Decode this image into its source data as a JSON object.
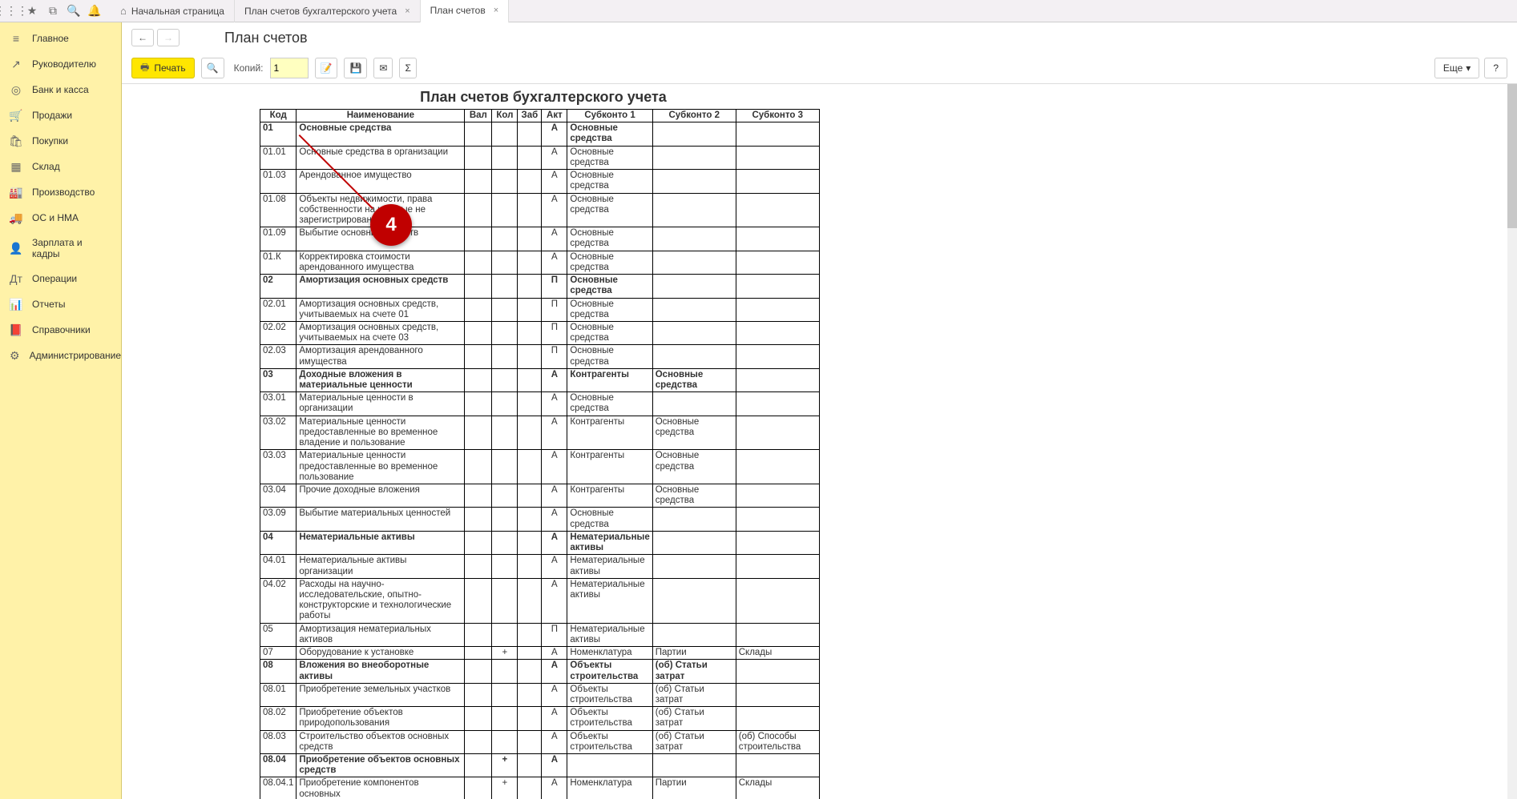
{
  "topbar": {
    "icons": [
      "apps",
      "star",
      "frames",
      "search",
      "bell"
    ]
  },
  "tabs": [
    {
      "label": "Начальная страница",
      "home": true,
      "close": false,
      "active": false
    },
    {
      "label": "План счетов бухгалтерского учета",
      "home": false,
      "close": true,
      "active": false
    },
    {
      "label": "План счетов",
      "home": false,
      "close": true,
      "active": true
    }
  ],
  "sidebar": [
    {
      "icon": "≡",
      "label": "Главное"
    },
    {
      "icon": "↗",
      "label": "Руководителю"
    },
    {
      "icon": "◎",
      "label": "Банк и касса"
    },
    {
      "icon": "🛒",
      "label": "Продажи"
    },
    {
      "icon": "🛍",
      "label": "Покупки"
    },
    {
      "icon": "▦",
      "label": "Склад"
    },
    {
      "icon": "🏭",
      "label": "Производство"
    },
    {
      "icon": "🚚",
      "label": "ОС и НМА"
    },
    {
      "icon": "👤",
      "label": "Зарплата и кадры"
    },
    {
      "icon": "Дт",
      "label": "Операции"
    },
    {
      "icon": "📊",
      "label": "Отчеты"
    },
    {
      "icon": "📕",
      "label": "Справочники"
    },
    {
      "icon": "⚙",
      "label": "Администрирование"
    }
  ],
  "page_title": "План счетов",
  "toolbar": {
    "print": "Печать",
    "copies_label": "Копий:",
    "copies_value": "1",
    "more": "Еще",
    "help": "?"
  },
  "doc_title": "План счетов бухгалтерского учета",
  "callout": "4",
  "columns": [
    "Код",
    "Наименование",
    "Вал",
    "Кол",
    "Заб",
    "Акт",
    "Субконто 1",
    "Субконто 2",
    "Субконто 3"
  ],
  "chart_data": {
    "type": "table",
    "title": "План счетов бухгалтерского учета",
    "columns": [
      "Код",
      "Наименование",
      "Вал",
      "Кол",
      "Заб",
      "Акт",
      "Субконто 1",
      "Субконто 2",
      "Субконто 3"
    ],
    "rows": [
      {
        "bold": true,
        "cells": [
          "01",
          "Основные средства",
          "",
          "",
          "",
          "А",
          "Основные средства",
          "",
          ""
        ]
      },
      {
        "cells": [
          "01.01",
          "Основные средства в организации",
          "",
          "",
          "",
          "А",
          "Основные средства",
          "",
          ""
        ]
      },
      {
        "cells": [
          "01.03",
          "Арендованное имущество",
          "",
          "",
          "",
          "А",
          "Основные средства",
          "",
          ""
        ]
      },
      {
        "cells": [
          "01.08",
          "Объекты недвижимости, права собственности на которые не зарегистрированы",
          "",
          "",
          "",
          "А",
          "Основные средства",
          "",
          ""
        ]
      },
      {
        "cells": [
          "01.09",
          "Выбытие основных средств",
          "",
          "",
          "",
          "А",
          "Основные средства",
          "",
          ""
        ]
      },
      {
        "cells": [
          "01.К",
          "Корректировка стоимости арендованного имущества",
          "",
          "",
          "",
          "А",
          "Основные средства",
          "",
          ""
        ]
      },
      {
        "bold": true,
        "cells": [
          "02",
          "Амортизация основных средств",
          "",
          "",
          "",
          "П",
          "Основные средства",
          "",
          ""
        ]
      },
      {
        "cells": [
          "02.01",
          "Амортизация основных средств, учитываемых на счете 01",
          "",
          "",
          "",
          "П",
          "Основные средства",
          "",
          ""
        ]
      },
      {
        "cells": [
          "02.02",
          "Амортизация основных средств, учитываемых на счете 03",
          "",
          "",
          "",
          "П",
          "Основные средства",
          "",
          ""
        ]
      },
      {
        "cells": [
          "02.03",
          "Амортизация арендованного имущества",
          "",
          "",
          "",
          "П",
          "Основные средства",
          "",
          ""
        ]
      },
      {
        "bold": true,
        "cells": [
          "03",
          "Доходные вложения в материальные ценности",
          "",
          "",
          "",
          "А",
          "Контрагенты",
          "Основные средства",
          ""
        ]
      },
      {
        "cells": [
          "03.01",
          "Материальные ценности в организации",
          "",
          "",
          "",
          "А",
          "Основные средства",
          "",
          ""
        ]
      },
      {
        "cells": [
          "03.02",
          "Материальные ценности предоставленные во временное владение и пользование",
          "",
          "",
          "",
          "А",
          "Контрагенты",
          "Основные средства",
          ""
        ]
      },
      {
        "cells": [
          "03.03",
          "Материальные ценности предоставленные во временное пользование",
          "",
          "",
          "",
          "А",
          "Контрагенты",
          "Основные средства",
          ""
        ]
      },
      {
        "cells": [
          "03.04",
          "Прочие доходные вложения",
          "",
          "",
          "",
          "А",
          "Контрагенты",
          "Основные средства",
          ""
        ]
      },
      {
        "cells": [
          "03.09",
          "Выбытие материальных ценностей",
          "",
          "",
          "",
          "А",
          "Основные средства",
          "",
          ""
        ]
      },
      {
        "bold": true,
        "cells": [
          "04",
          "Нематериальные активы",
          "",
          "",
          "",
          "А",
          "Нематериальные активы",
          "",
          ""
        ]
      },
      {
        "cells": [
          "04.01",
          "Нематериальные активы организации",
          "",
          "",
          "",
          "А",
          "Нематериальные активы",
          "",
          ""
        ]
      },
      {
        "cells": [
          "04.02",
          "Расходы на научно-исследовательские, опытно-конструкторские и технологические работы",
          "",
          "",
          "",
          "А",
          "Нематериальные активы",
          "",
          ""
        ]
      },
      {
        "cells": [
          "05",
          "Амортизация нематериальных активов",
          "",
          "",
          "",
          "П",
          "Нематериальные активы",
          "",
          ""
        ]
      },
      {
        "cells": [
          "07",
          "Оборудование к установке",
          "",
          "+",
          "",
          "А",
          "Номенклатура",
          "Партии",
          "Склады"
        ]
      },
      {
        "bold": true,
        "cells": [
          "08",
          "Вложения во внеоборотные активы",
          "",
          "",
          "",
          "А",
          "Объекты строительства",
          "(об) Статьи затрат",
          ""
        ]
      },
      {
        "cells": [
          "08.01",
          "Приобретение земельных участков",
          "",
          "",
          "",
          "А",
          "Объекты строительства",
          "(об) Статьи затрат",
          ""
        ]
      },
      {
        "cells": [
          "08.02",
          "Приобретение объектов природопользования",
          "",
          "",
          "",
          "А",
          "Объекты строительства",
          "(об) Статьи затрат",
          ""
        ]
      },
      {
        "cells": [
          "08.03",
          "Строительство объектов основных средств",
          "",
          "",
          "",
          "А",
          "Объекты строительства",
          "(об) Статьи затрат",
          "(об) Способы строительства"
        ]
      },
      {
        "bold": true,
        "cells": [
          "08.04",
          "Приобретение объектов основных средств",
          "",
          "+",
          "",
          "А",
          "",
          "",
          ""
        ]
      },
      {
        "cells": [
          "08.04.1",
          "Приобретение компонентов основных",
          "",
          "+",
          "",
          "А",
          "Номенклатура",
          "Партии",
          "Склады"
        ]
      }
    ]
  }
}
